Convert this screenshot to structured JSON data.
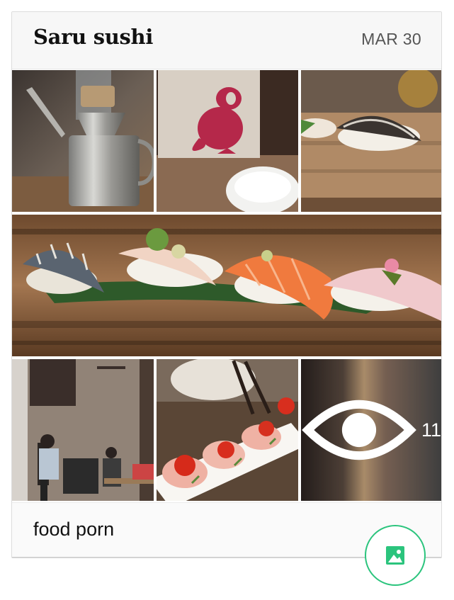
{
  "post": {
    "title": "Saru sushi",
    "date": "MAR 30",
    "caption": "food porn",
    "hidden_photo_count": "11"
  },
  "photos": [
    {
      "name": "sauce-pitcher-photo"
    },
    {
      "name": "monkey-card-photo"
    },
    {
      "name": "nigiri-plate-photo"
    },
    {
      "name": "nigiri-row-photo"
    },
    {
      "name": "restaurant-interior-photo"
    },
    {
      "name": "sashimi-plate-photo"
    },
    {
      "name": "more-photos-photo"
    }
  ],
  "icons": {
    "more": "eye-icon",
    "add_photo": "image-icon"
  },
  "colors": {
    "accent": "#2bc47d",
    "header_bg": "#f7f7f7",
    "title": "#111111",
    "date": "#555555"
  }
}
